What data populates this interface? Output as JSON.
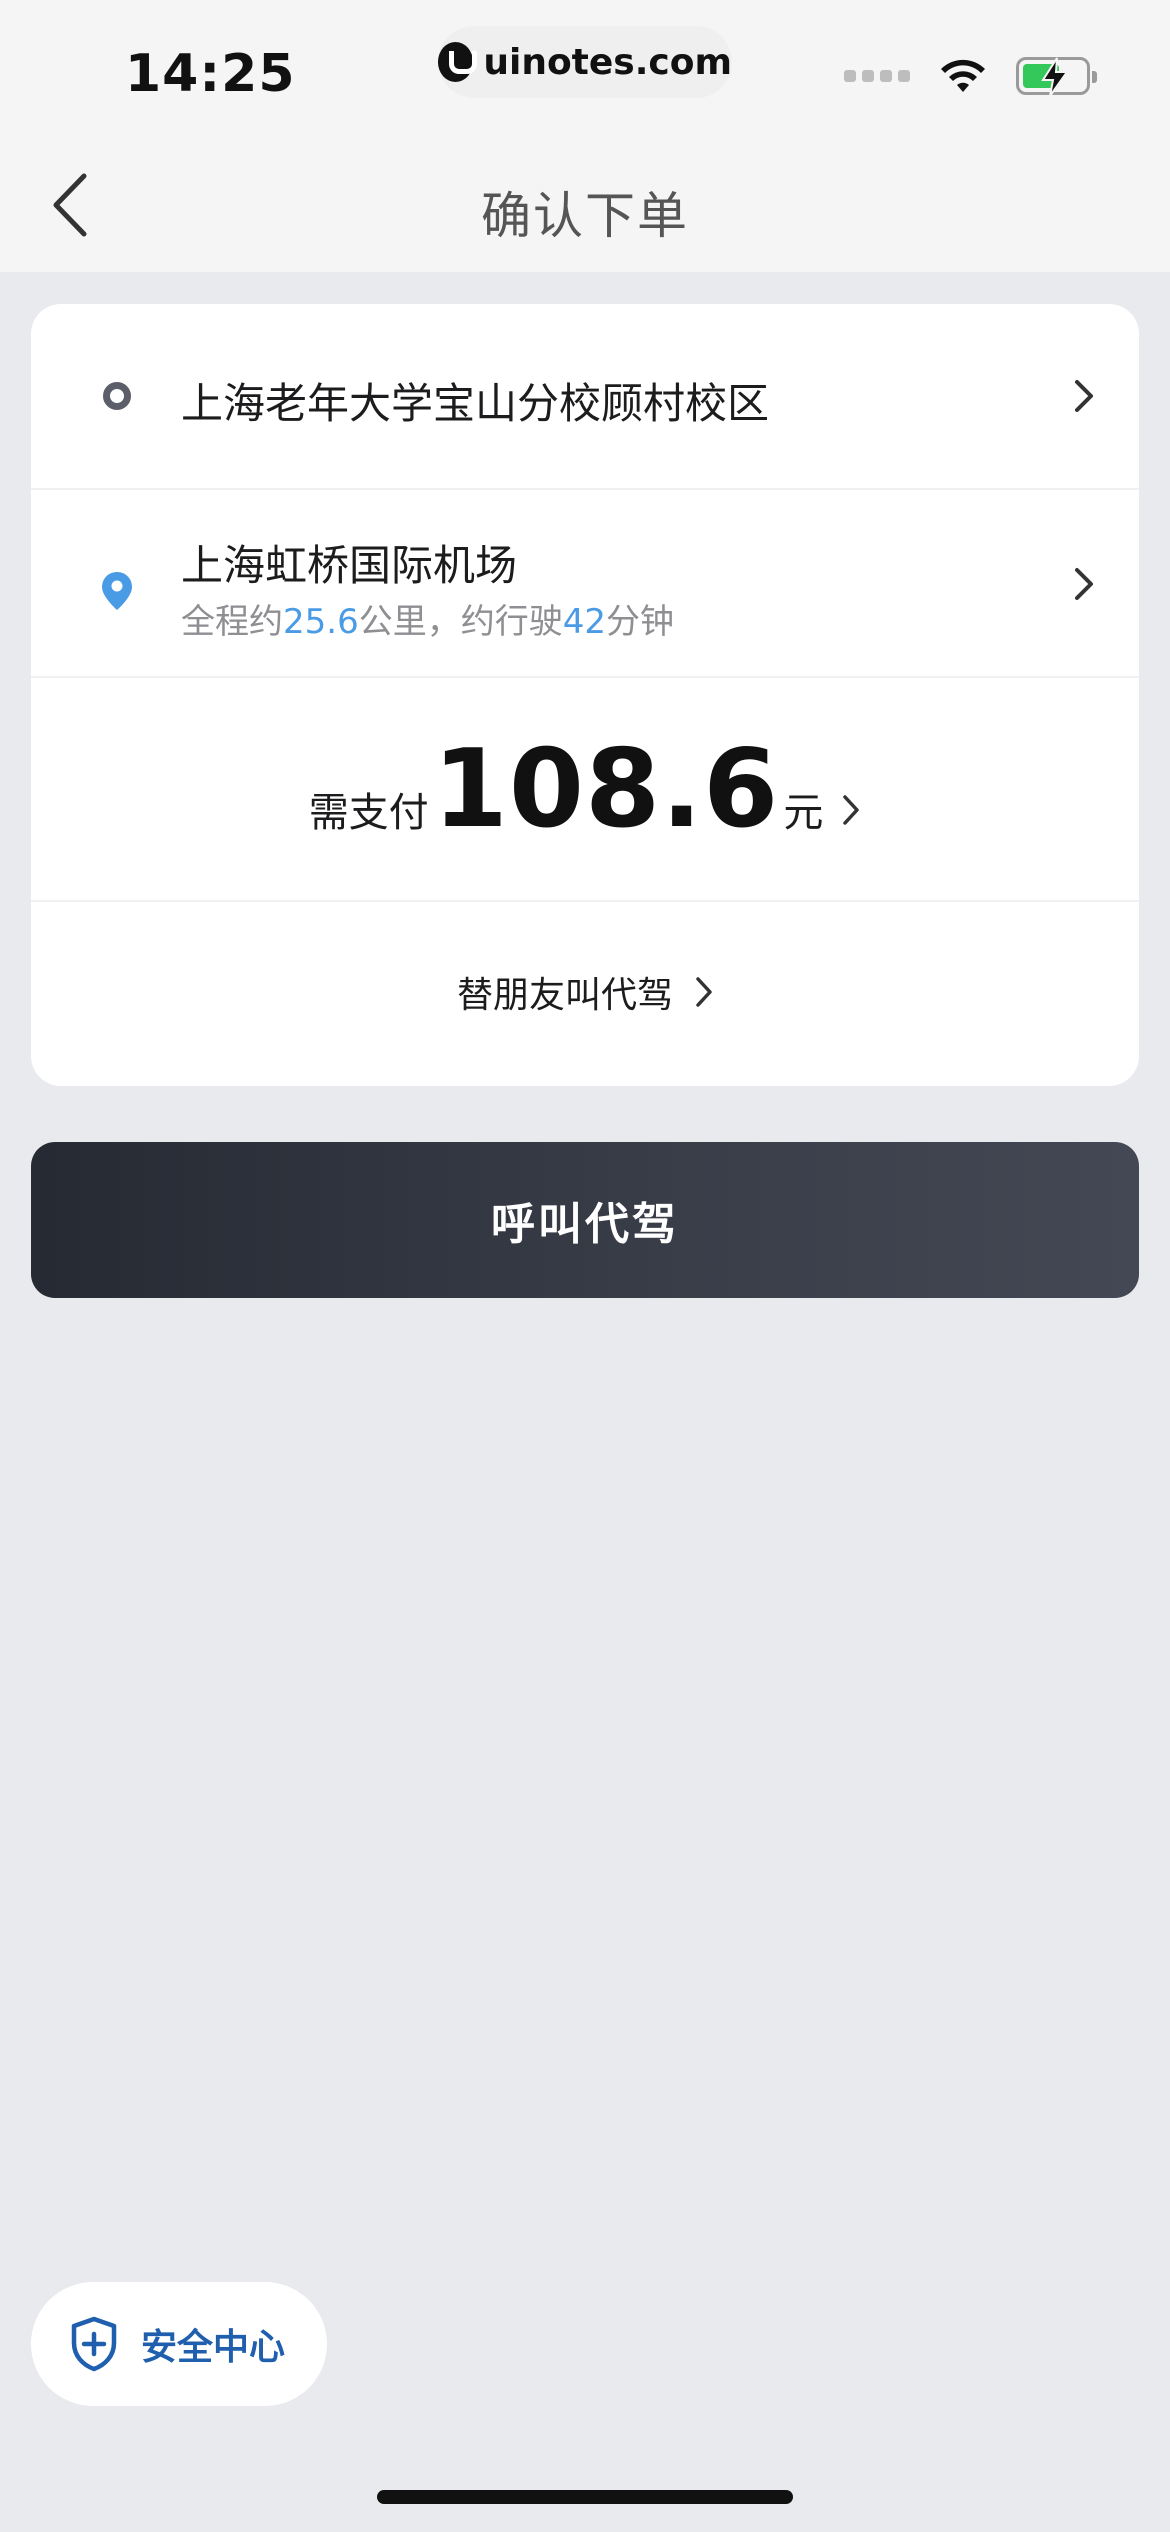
{
  "status_bar": {
    "time": "14:25",
    "url": "uinotes.com",
    "icons": [
      "signal-dots-icon",
      "wifi-icon",
      "battery-charging-icon"
    ]
  },
  "nav": {
    "back_icon": "chevron-left-icon",
    "title": "确认下单"
  },
  "route": {
    "origin": "上海老年大学宝山分校顾村校区",
    "destination": "上海虹桥国际机场",
    "summary_prefix": "全程约",
    "distance": "25.6",
    "summary_mid": "公里，约行驶",
    "duration": "42",
    "summary_suffix": "分钟"
  },
  "payment": {
    "label": "需支付",
    "amount": "108.6",
    "unit": "元"
  },
  "friend": {
    "label": "替朋友叫代驾"
  },
  "actions": {
    "call_label": "呼叫代驾"
  },
  "safety": {
    "label": "安全中心",
    "icon": "shield-plus-icon"
  },
  "colors": {
    "accent_blue": "#4a9be6",
    "button_dark": "#262a33",
    "safety_blue": "#1f5fae",
    "background": "#e9eaee"
  }
}
